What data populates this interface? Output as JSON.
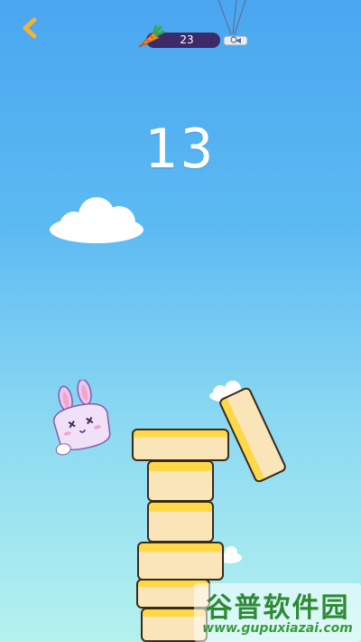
{
  "hud": {
    "carrot_count": "23",
    "score": "13"
  },
  "watermark": {
    "logo_text": "谷普软件园",
    "url": "www.gupuxiazai.com"
  },
  "colors": {
    "sky_top": "#4aa6f0",
    "sky_bottom": "#b4f2ee",
    "block_top": "#ffd84a",
    "block_body": "#f9e5b8",
    "counter_bg": "#3d2a6a",
    "back_arrow": "#f2b23a"
  },
  "icons": [
    "back-arrow-icon",
    "carrot-icon",
    "balloon-gift-icon",
    "cloud-icon",
    "rabbit-character"
  ]
}
